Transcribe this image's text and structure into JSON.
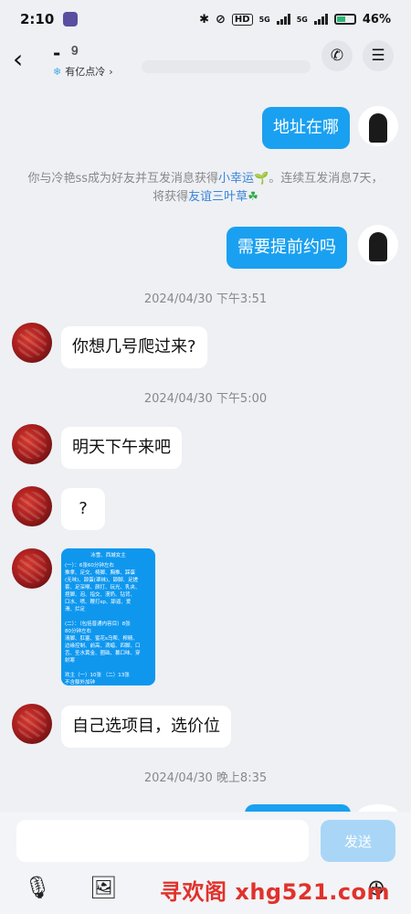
{
  "status_bar": {
    "time": "2:10",
    "right_text": "46%",
    "net1": "5G",
    "net2": "5G"
  },
  "header": {
    "title": "-",
    "subtitle": "有亿点冷",
    "back_icon": "back-chevron-icon",
    "call_icon": "phone-icon",
    "menu_icon": "menu-icon"
  },
  "messages": {
    "m1": "地址在哪",
    "sys_line1_pre": "你与冷艳ss成为好友并互发消息获得",
    "sys_line1_hl": "小幸运",
    "sys_line1_post": "。连续互发消息7天，",
    "sys_line2_pre": "将获得",
    "sys_line2_hl": "友谊三叶草",
    "m2": "需要提前约吗",
    "t1": "2024/04/30 下午3:51",
    "m3": "你想几号爬过来?",
    "t2": "2024/04/30 下午5:00",
    "m4": "明天下午来吧",
    "m5": "?",
    "image_title": "冰雪、西城女主",
    "image_lines": [
      "(一）：6张60分钟左右",
      "推拿、足交、椅脚、胸推、踩蛋",
      "(无味)、舔蛋(罩袜)、舔脚、足搓",
      "套、足深喉、颜打、玩光、乳夹、",
      "捏脚、泡、指交、漫奶、钻背、",
      "口水、喷、鞭打sp、舔逼、爱",
      "滑、拦足",
      "",
      "(二）：（包括普通内容目）8张",
      "80分钟左右",
      "清脚、肛塞、蜜花s乌帮、榨精、",
      "边缘控制、前高、滴蜡、四脚、口",
      "舌、圣水黄金、圈础、篡口味、穿",
      "射寒",
      "",
      "欢主（一）10张    （二）13张",
      "不含额外加钟"
    ],
    "m6": "自己选项目，选价位",
    "t3": "2024/04/30 晚上8:35"
  },
  "composer": {
    "send_label": "发送"
  },
  "toolbar": [
    "mic-icon",
    "image-icon",
    "plus-icon"
  ],
  "watermark": "寻欢阁 xhg521.com",
  "colors": {
    "accent": "#1aa0f0",
    "background": "#eef0f4",
    "timestamp": "#888888",
    "highlight": "#3a84d8"
  }
}
